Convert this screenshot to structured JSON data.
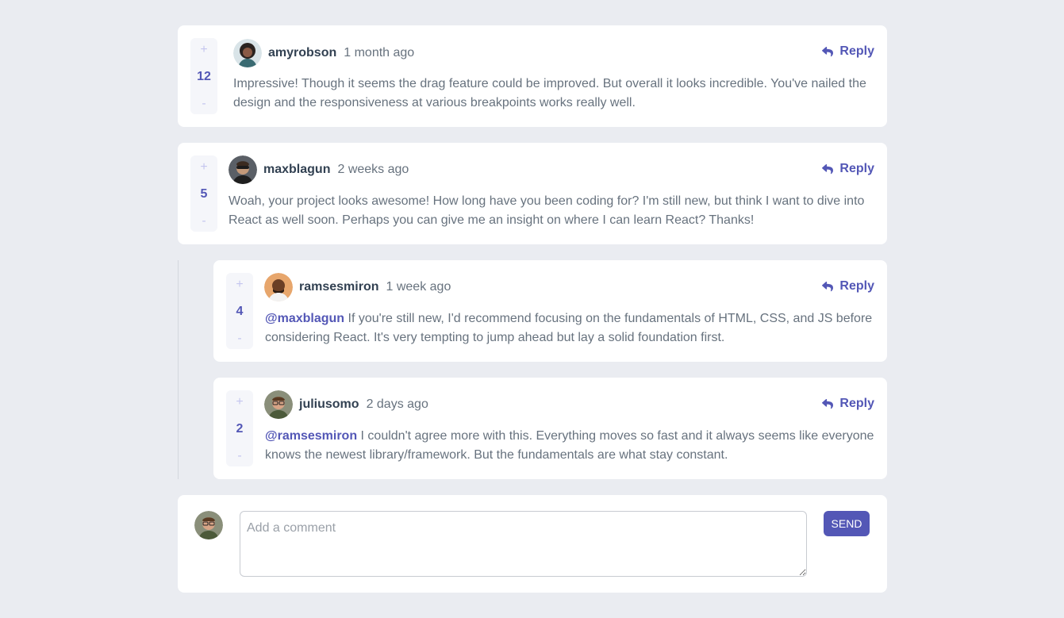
{
  "reply_label": "Reply",
  "comments": [
    {
      "user": "amyrobson",
      "time": "1 month ago",
      "score": "12",
      "plus": "+",
      "minus": "-",
      "text": "Impressive! Though it seems the drag feature could be improved. But overall it looks incredible. You've nailed the design and the responsiveness at various breakpoints works really well."
    },
    {
      "user": "maxblagun",
      "time": "2 weeks ago",
      "score": "5",
      "plus": "+",
      "minus": "-",
      "text": "Woah, your project looks awesome! How long have you been coding for? I'm still new, but think I want to dive into React as well soon. Perhaps you can give me an insight on where I can learn React? Thanks!"
    }
  ],
  "replies": [
    {
      "user": "ramsesmiron",
      "time": "1 week ago",
      "score": "4",
      "plus": "+",
      "minus": "-",
      "mention": "@maxblagun",
      "text": " If you're still new, I'd recommend focusing on the fundamentals of HTML, CSS, and JS before considering React. It's very tempting to jump ahead but lay a solid foundation first."
    },
    {
      "user": "juliusomo",
      "time": "2 days ago",
      "score": "2",
      "plus": "+",
      "minus": "-",
      "mention": "@ramsesmiron",
      "text": " I couldn't agree more with this. Everything moves so fast and it always seems like everyone knows the newest library/framework. But the fundamentals are what stay constant."
    }
  ],
  "composer": {
    "placeholder": "Add a comment",
    "send_label": "SEND"
  },
  "colors": {
    "accent": "#5357b6",
    "background": "#eaecf1",
    "card": "#ffffff",
    "username": "#324152",
    "body_text": "#67727e"
  }
}
